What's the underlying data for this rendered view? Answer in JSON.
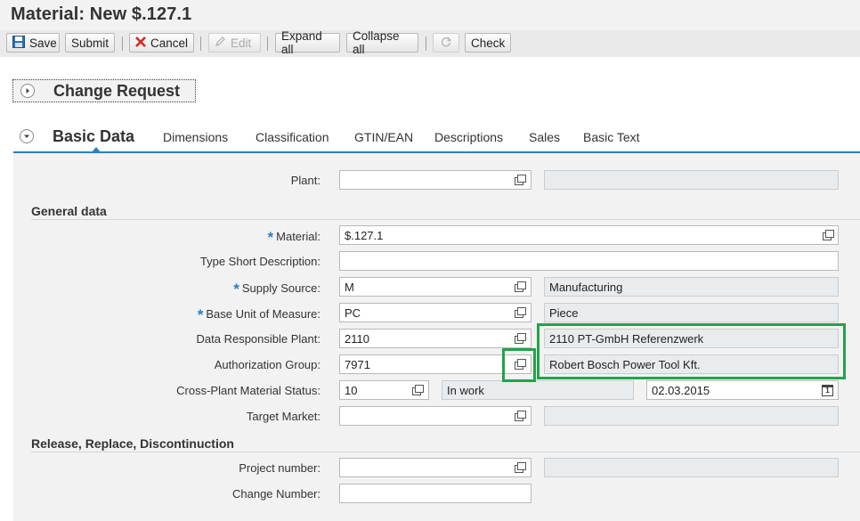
{
  "title": "Material: New $.127.1",
  "toolbar": {
    "save": "Save",
    "submit": "Submit",
    "cancel": "Cancel",
    "edit": "Edit",
    "expand_all": "Expand all",
    "collapse_all": "Collapse all",
    "check": "Check"
  },
  "change_request": {
    "title": "Change Request"
  },
  "tabs": [
    "Basic Data",
    "Dimensions",
    "Classification",
    "GTIN/EAN",
    "Descriptions",
    "Sales",
    "Basic Text"
  ],
  "plant": {
    "label": "Plant:",
    "value": "",
    "description": ""
  },
  "general_data": {
    "heading": "General data",
    "material": {
      "label": "Material:",
      "value": "$.127.1"
    },
    "short_description": {
      "label": "Type Short Description:",
      "value": ""
    },
    "supply_source": {
      "label": "Supply Source:",
      "value": "M",
      "description": "Manufacturing"
    },
    "base_unit": {
      "label": "Base Unit of Measure:",
      "value": "PC",
      "description": "Piece"
    },
    "data_responsible_plant": {
      "label": "Data Responsible Plant:",
      "value": "2110",
      "description": "2110 PT-GmbH Referenzwerk"
    },
    "authorization_group": {
      "label": "Authorization Group:",
      "value": "7971",
      "description": "Robert Bosch Power Tool Kft."
    },
    "cross_plant_status": {
      "label": "Cross-Plant Material Status:",
      "value": "10",
      "description": "In work",
      "date": "02.03.2015"
    },
    "target_market": {
      "label": "Target Market:",
      "value": "",
      "description": ""
    }
  },
  "release": {
    "heading": "Release, Replace, Discontinuction",
    "project_number": {
      "label": "Project number:",
      "value": "",
      "description": ""
    },
    "change_number": {
      "label": "Change Number:",
      "value": ""
    }
  },
  "required_marker": "*",
  "colors": {
    "accent": "#2b7fc1",
    "highlight": "#22a34a"
  }
}
